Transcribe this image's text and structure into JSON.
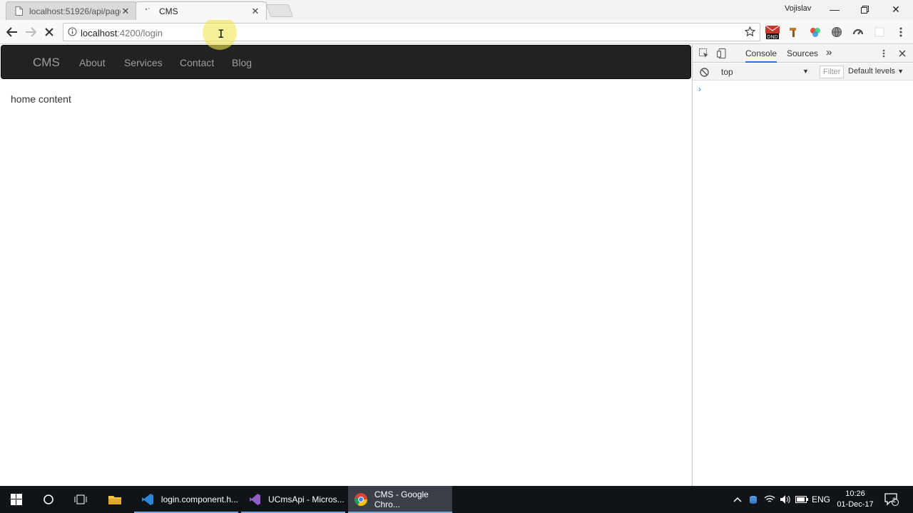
{
  "browser": {
    "tabs": [
      {
        "title": "localhost:51926/api/pagé",
        "active": false
      },
      {
        "title": "CMS",
        "active": true
      }
    ],
    "profile_name": "Vojislav",
    "address": {
      "host": "localhost",
      "path": ":4200/login"
    },
    "extensions": [
      "dnd-mail-icon",
      "hammer-icon",
      "color-wheel-icon",
      "globe-icon",
      "speed-icon",
      "blank-icon"
    ]
  },
  "page": {
    "navbar": {
      "brand": "CMS",
      "links": [
        "About",
        "Services",
        "Contact",
        "Blog"
      ]
    },
    "content": "home content"
  },
  "devtools": {
    "tabs": [
      "Console",
      "Sources"
    ],
    "more": "»",
    "context": "top",
    "filter_placeholder": "Filter",
    "levels": "Default levels",
    "prompt": "›"
  },
  "taskbar": {
    "apps": [
      {
        "label": "login.component.h...",
        "icon": "vscode-icon",
        "active": false
      },
      {
        "label": "UCmsApi - Micros...",
        "icon": "visual-studio-icon",
        "active": false
      },
      {
        "label": "CMS - Google Chro...",
        "icon": "chrome-icon",
        "active": true
      }
    ],
    "lang": "ENG",
    "time": "10:26",
    "date": "01-Dec-17",
    "notif_count": "2"
  },
  "colors": {
    "navbar_bg": "#222222",
    "nav_link": "#9d9d9d",
    "taskbar_bg": "#101318",
    "devtools_accent": "#1a73e8"
  }
}
